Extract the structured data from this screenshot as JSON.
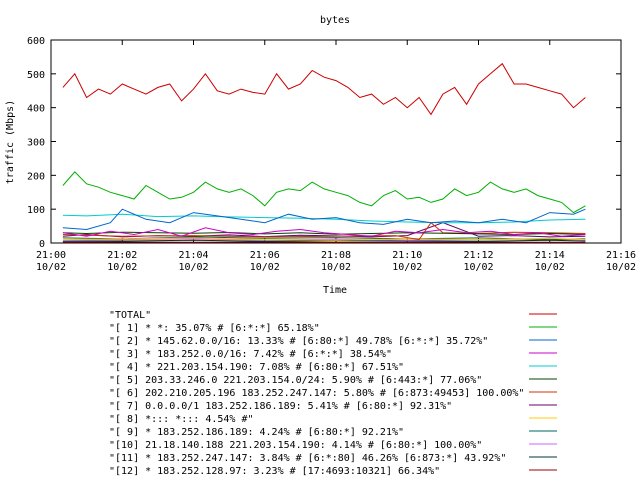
{
  "chart_data": {
    "type": "line",
    "title": "bytes",
    "xlabel": "Time",
    "ylabel": "traffic (Mbps)",
    "ylim": [
      0,
      600
    ],
    "xlim": [
      "2009-10-02 21:00",
      "2009-10-02 21:16"
    ],
    "yticks": [
      0,
      100,
      200,
      300,
      400,
      500,
      600
    ],
    "xticks": [
      {
        "time": "21:00",
        "date": "10/02"
      },
      {
        "time": "21:02",
        "date": "10/02"
      },
      {
        "time": "21:04",
        "date": "10/02"
      },
      {
        "time": "21:06",
        "date": "10/02"
      },
      {
        "time": "21:08",
        "date": "10/02"
      },
      {
        "time": "21:10",
        "date": "10/02"
      },
      {
        "time": "21:12",
        "date": "10/02"
      },
      {
        "time": "21:14",
        "date": "10/02"
      },
      {
        "time": "21:16",
        "date": "10/02"
      }
    ],
    "legend_position": "bottom",
    "series": [
      {
        "name": "\"TOTAL\"",
        "color": "#cc0000",
        "x": [
          "21:00:20",
          "21:00:40",
          "21:01:00",
          "21:01:20",
          "21:01:40",
          "21:02:00",
          "21:02:20",
          "21:02:40",
          "21:03:00",
          "21:03:20",
          "21:03:40",
          "21:04:00",
          "21:04:20",
          "21:04:40",
          "21:05:00",
          "21:05:20",
          "21:05:40",
          "21:06:00",
          "21:06:20",
          "21:06:40",
          "21:07:00",
          "21:07:20",
          "21:07:40",
          "21:08:00",
          "21:08:20",
          "21:08:40",
          "21:09:00",
          "21:09:20",
          "21:09:40",
          "21:10:00",
          "21:10:20",
          "21:10:40",
          "21:11:00",
          "21:11:20",
          "21:11:40",
          "21:12:00",
          "21:12:20",
          "21:12:40",
          "21:13:00",
          "21:13:20",
          "21:13:40",
          "21:14:00",
          "21:14:20",
          "21:14:40",
          "21:15:00"
        ],
        "values": [
          460,
          500,
          430,
          455,
          440,
          470,
          455,
          440,
          460,
          470,
          420,
          455,
          500,
          450,
          440,
          455,
          445,
          440,
          500,
          455,
          470,
          510,
          490,
          480,
          460,
          430,
          440,
          410,
          430,
          400,
          430,
          380,
          440,
          460,
          410,
          470,
          500,
          530,
          470,
          470,
          460,
          450,
          440,
          400,
          430
        ]
      },
      {
        "name": "\"[ 1] * *: 35.07% # [6:*:*] 65.18%\"",
        "color": "#00b000",
        "x": [
          "21:00:20",
          "21:00:40",
          "21:01:00",
          "21:01:20",
          "21:01:40",
          "21:02:00",
          "21:02:20",
          "21:02:40",
          "21:03:00",
          "21:03:20",
          "21:03:40",
          "21:04:00",
          "21:04:20",
          "21:04:40",
          "21:05:00",
          "21:05:20",
          "21:05:40",
          "21:06:00",
          "21:06:20",
          "21:06:40",
          "21:07:00",
          "21:07:20",
          "21:07:40",
          "21:08:00",
          "21:08:20",
          "21:08:40",
          "21:09:00",
          "21:09:20",
          "21:09:40",
          "21:10:00",
          "21:10:20",
          "21:10:40",
          "21:11:00",
          "21:11:20",
          "21:11:40",
          "21:12:00",
          "21:12:20",
          "21:12:40",
          "21:13:00",
          "21:13:20",
          "21:13:40",
          "21:14:00",
          "21:14:20",
          "21:14:40",
          "21:15:00"
        ],
        "values": [
          170,
          210,
          175,
          165,
          150,
          140,
          130,
          170,
          150,
          130,
          135,
          150,
          180,
          160,
          150,
          160,
          140,
          110,
          150,
          160,
          155,
          180,
          160,
          150,
          140,
          120,
          110,
          140,
          155,
          130,
          135,
          120,
          130,
          160,
          140,
          150,
          180,
          160,
          150,
          160,
          140,
          130,
          120,
          90,
          110
        ]
      },
      {
        "name": "\"[ 2] * 145.62.0.0/16: 13.33% # [6:80:*] 49.78% [6:*:*] 35.72%\"",
        "color": "#0066cc",
        "x": [
          "21:00:20",
          "21:01:00",
          "21:01:40",
          "21:02:00",
          "21:02:40",
          "21:03:20",
          "21:04:00",
          "21:04:40",
          "21:05:20",
          "21:06:00",
          "21:06:40",
          "21:07:20",
          "21:08:00",
          "21:08:40",
          "21:09:20",
          "21:10:00",
          "21:10:40",
          "21:11:20",
          "21:12:00",
          "21:12:40",
          "21:13:20",
          "21:14:00",
          "21:14:40",
          "21:15:00"
        ],
        "values": [
          45,
          40,
          60,
          100,
          70,
          60,
          90,
          80,
          70,
          60,
          85,
          70,
          75,
          60,
          55,
          70,
          60,
          65,
          60,
          70,
          60,
          90,
          85,
          100
        ]
      },
      {
        "name": "\"[ 3] * 183.252.0.0/16: 7.42% # [6:*:*] 38.54%\"",
        "color": "#cc00cc",
        "x": [
          "21:00:20",
          "21:01:00",
          "21:01:40",
          "21:02:20",
          "21:03:00",
          "21:03:40",
          "21:04:20",
          "21:05:00",
          "21:05:40",
          "21:06:20",
          "21:07:00",
          "21:07:40",
          "21:08:20",
          "21:09:00",
          "21:09:40",
          "21:10:20",
          "21:11:00",
          "21:11:40",
          "21:12:20",
          "21:13:00",
          "21:13:40",
          "21:14:20",
          "21:15:00"
        ],
        "values": [
          30,
          20,
          35,
          25,
          40,
          20,
          45,
          30,
          25,
          35,
          40,
          30,
          25,
          20,
          35,
          30,
          40,
          30,
          35,
          25,
          30,
          20,
          25
        ]
      },
      {
        "name": "\"[ 4] * 221.203.154.190: 7.08% # [6:80:*] 67.51%\"",
        "color": "#00cccc",
        "x": [
          "21:00:20",
          "21:01:00",
          "21:02:00",
          "21:03:00",
          "21:04:00",
          "21:05:00",
          "21:06:00",
          "21:07:00",
          "21:08:00",
          "21:09:00",
          "21:10:00",
          "21:11:00",
          "21:12:00",
          "21:13:00",
          "21:14:00",
          "21:15:00"
        ],
        "values": [
          82,
          80,
          85,
          78,
          80,
          77,
          75,
          73,
          70,
          65,
          62,
          60,
          60,
          62,
          68,
          70
        ]
      },
      {
        "name": "\"[ 5] 203.33.246.0 221.203.154.0/24: 5.90% # [6:443:*] 77.06%\"",
        "color": "#004400",
        "x": [
          "21:00:20",
          "21:01:00",
          "21:02:00",
          "21:03:00",
          "21:04:00",
          "21:05:00",
          "21:06:00",
          "21:07:00",
          "21:08:00",
          "21:09:00",
          "21:10:00",
          "21:11:00",
          "21:12:00",
          "21:13:00",
          "21:14:00",
          "21:15:00"
        ],
        "values": [
          30,
          28,
          32,
          30,
          29,
          31,
          27,
          30,
          26,
          28,
          30,
          29,
          27,
          25,
          28,
          25
        ]
      },
      {
        "name": "\"[ 6] 202.210.205.196 183.252.247.147: 5.80% # [6:873:49453] 100.00%\"",
        "color": "#cc3300",
        "x": [
          "21:00:20",
          "21:02:00",
          "21:04:00",
          "21:06:00",
          "21:08:00",
          "21:09:40",
          "21:10:20",
          "21:10:40",
          "21:11:00",
          "21:12:00",
          "21:13:00",
          "21:14:00",
          "21:15:00"
        ],
        "values": [
          25,
          20,
          22,
          18,
          20,
          22,
          10,
          60,
          30,
          28,
          32,
          30,
          28
        ]
      },
      {
        "name": "\"[ 7] 0.0.0.0/1 183.252.186.189: 5.41% # [6:80:*] 92.31%\"",
        "color": "#660066",
        "x": [
          "21:00:20",
          "21:01:00",
          "21:02:00",
          "21:03:00",
          "21:04:00",
          "21:05:00",
          "21:06:00",
          "21:07:00",
          "21:08:00",
          "21:09:00",
          "21:10:00",
          "21:11:00",
          "21:12:00",
          "21:13:00",
          "21:14:00",
          "21:15:00"
        ],
        "values": [
          20,
          25,
          18,
          22,
          20,
          24,
          19,
          23,
          21,
          18,
          22,
          60,
          20,
          22,
          18,
          20
        ]
      },
      {
        "name": "\"[ 8] *::: *::: 4.54% #\"",
        "color": "#ffcc00",
        "x": [
          "21:00:20",
          "21:02:00",
          "21:04:00",
          "21:06:00",
          "21:08:00",
          "21:10:00",
          "21:12:00",
          "21:14:00",
          "21:15:00"
        ],
        "values": [
          10,
          12,
          15,
          10,
          8,
          12,
          10,
          14,
          10
        ]
      },
      {
        "name": "\"[ 9] * 183.252.186.189: 4.24% # [6:80:*] 92.21%\"",
        "color": "#006666",
        "x": [
          "21:00:20",
          "21:02:00",
          "21:04:00",
          "21:06:00",
          "21:08:00",
          "21:10:00",
          "21:12:00",
          "21:14:00",
          "21:15:00"
        ],
        "values": [
          15,
          12,
          18,
          14,
          16,
          12,
          15,
          10,
          12
        ]
      },
      {
        "name": "\"[10] 21.18.140.188 221.203.154.190: 4.14% # [6:80:*] 100.00%\"",
        "color": "#cc66ff",
        "x": [
          "21:00:20",
          "21:02:00",
          "21:04:00",
          "21:06:00",
          "21:08:00",
          "21:10:00",
          "21:12:00",
          "21:14:00",
          "21:15:00"
        ],
        "values": [
          8,
          10,
          12,
          9,
          11,
          8,
          10,
          12,
          9
        ]
      },
      {
        "name": "\"[11] * 183.252.247.147: 3.84% # [6:*:80] 46.26% [6:873:*] 43.92%\"",
        "color": "#003333",
        "x": [
          "21:00:20",
          "21:02:00",
          "21:04:00",
          "21:06:00",
          "21:08:00",
          "21:10:00",
          "21:12:00",
          "21:14:00",
          "21:15:00"
        ],
        "values": [
          5,
          6,
          8,
          5,
          7,
          6,
          5,
          8,
          6
        ]
      },
      {
        "name": "\"[12] * 183.252.128.97: 3.23% # [17:4693:10321] 66.34%\"",
        "color": "#990000",
        "x": [
          "21:00:20",
          "21:02:00",
          "21:04:00",
          "21:06:00",
          "21:08:00",
          "21:10:00",
          "21:12:00",
          "21:14:00",
          "21:15:00"
        ],
        "values": [
          2,
          3,
          2,
          3,
          2,
          2,
          3,
          2,
          2
        ]
      }
    ]
  }
}
